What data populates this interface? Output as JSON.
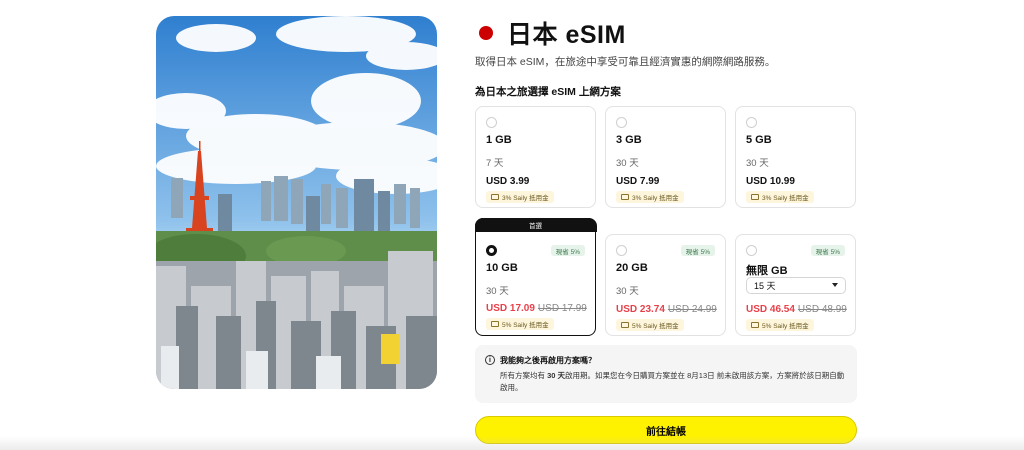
{
  "header": {
    "title": "日本 eSIM",
    "flag_color": "#cc0000",
    "subtitle": "取得日本 eSIM，在旅途中享受可靠且經濟實惠的網際網路服務。"
  },
  "plans_section": {
    "label": "為日本之旅選擇 eSIM 上網方案"
  },
  "plans": [
    {
      "name": "1 GB",
      "days": "7 天",
      "price": "USD 3.99",
      "old_price": "",
      "credit": "3% Saily 抵用金",
      "save": "",
      "recommend": "",
      "selected": false
    },
    {
      "name": "3 GB",
      "days": "30 天",
      "price": "USD 7.99",
      "old_price": "",
      "credit": "3% Saily 抵用金",
      "save": "",
      "recommend": "",
      "selected": false
    },
    {
      "name": "5 GB",
      "days": "30 天",
      "price": "USD 10.99",
      "old_price": "",
      "credit": "3% Saily 抵用金",
      "save": "",
      "recommend": "",
      "selected": false
    },
    {
      "name": "10 GB",
      "days": "30 天",
      "price": "USD 17.09",
      "old_price": "USD 17.99",
      "credit": "5% Saily 抵用金",
      "save": "現省 5%",
      "recommend": "首選",
      "selected": true
    },
    {
      "name": "20 GB",
      "days": "30 天",
      "price": "USD 23.74",
      "old_price": "USD 24.99",
      "credit": "5% Saily 抵用金",
      "save": "現省 5%",
      "recommend": "",
      "selected": false
    },
    {
      "name": "無限 GB",
      "days": "15 天",
      "price": "USD 46.54",
      "old_price": "USD 48.99",
      "credit": "5% Saily 抵用金",
      "save": "現省 5%",
      "recommend": "",
      "selected": false
    }
  ],
  "faq": {
    "question": "我能夠之後再啟用方案嗎？",
    "answer_pre": "所有方案均有 ",
    "answer_bold": "30 天",
    "answer_post": "啟用期。如果您在今日購買方案並在 8月13日 前未啟用該方案，方案將於該日期自動啟用。"
  },
  "checkout": {
    "label": "前往結帳",
    "color": "#fff200"
  },
  "colors": {
    "sale": "#e8404a",
    "credit_bg": "#fdf5dc",
    "save_bg": "#e6f3ea"
  }
}
